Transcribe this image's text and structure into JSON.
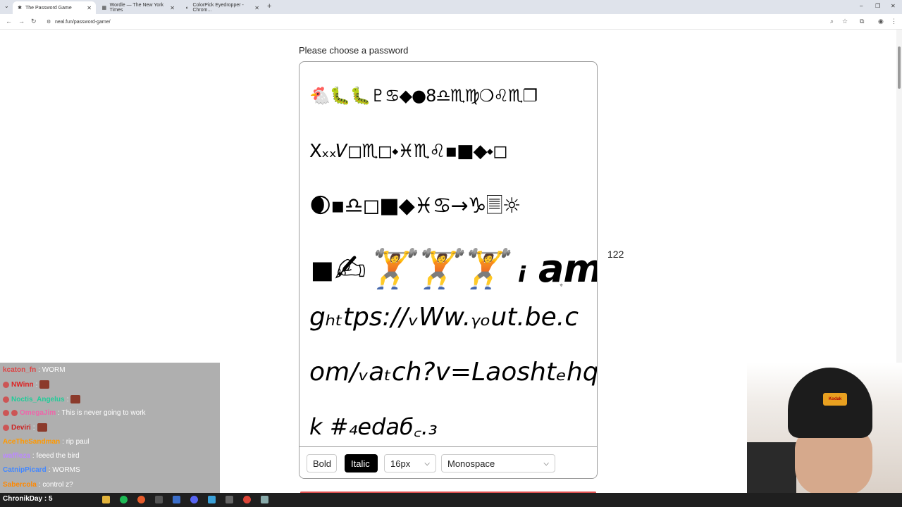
{
  "browser": {
    "tabs": [
      {
        "title": "The Password Game",
        "active": true
      },
      {
        "title": "Wordle — The New York Times",
        "active": false
      },
      {
        "title": "ColorPick Eyedropper - Chrom...",
        "active": false
      }
    ],
    "url": "neal.fun/password-game/"
  },
  "page": {
    "title": "Please choose a password",
    "char_count": "122"
  },
  "password": {
    "line1": "🐔🐛🐛♇♋◆●8♎♏♍❍♌♏❐",
    "line2": "Xₓₓ𝑉◻♏◻⬩♓♏♌▪■◆⬩◻",
    "line3": "🌒▪♎◻■◆♓♋→♑🗏☼",
    "line4": "▪✍🏋🏋🏋 ᵢ am eₙou",
    "line5": "gₕₜtps://ᵥWw.ᵧₒut.be.c",
    "line6": "om/ᵥaₜcℎ?v=Laoshtₑhqh",
    "line7": "k #₄edaб꜀.₃"
  },
  "toolbar": {
    "bold_label": "Bold",
    "italic_label": "Italic",
    "size_value": "16px",
    "font_value": "Monospace"
  },
  "chat": {
    "messages": [
      {
        "user": "kcaton_fn",
        "text": ": WORM",
        "color": "#d44"
      },
      {
        "user": "NWinn",
        "text": ":",
        "color": "#d22"
      },
      {
        "user": "Noctis_Angelus",
        "text": ":",
        "color": "#2c9"
      },
      {
        "user": "OmegaJim",
        "text": ": This is never going to work",
        "color": "#e6a"
      },
      {
        "user": "Deviri",
        "text": ":",
        "color": "#c22"
      },
      {
        "user": "AceTheSandman",
        "text": ": rip paul",
        "color": "#f90"
      },
      {
        "user": "waffleza",
        "text": ": feeed the bird",
        "color": "#b8f"
      },
      {
        "user": "CatnipPicard",
        "text": ": WORMS",
        "color": "#48f"
      },
      {
        "user": "Sabercola",
        "text": ": control z?",
        "color": "#f80"
      }
    ],
    "viewer_label": "ChronikDay : 5"
  },
  "webcam": {
    "patch_text": "Kodak"
  },
  "colors": {
    "italic_active_bg": "#000000",
    "chat_bg": "#6e6e6e",
    "taskbar_bg": "#1f1f1f"
  }
}
